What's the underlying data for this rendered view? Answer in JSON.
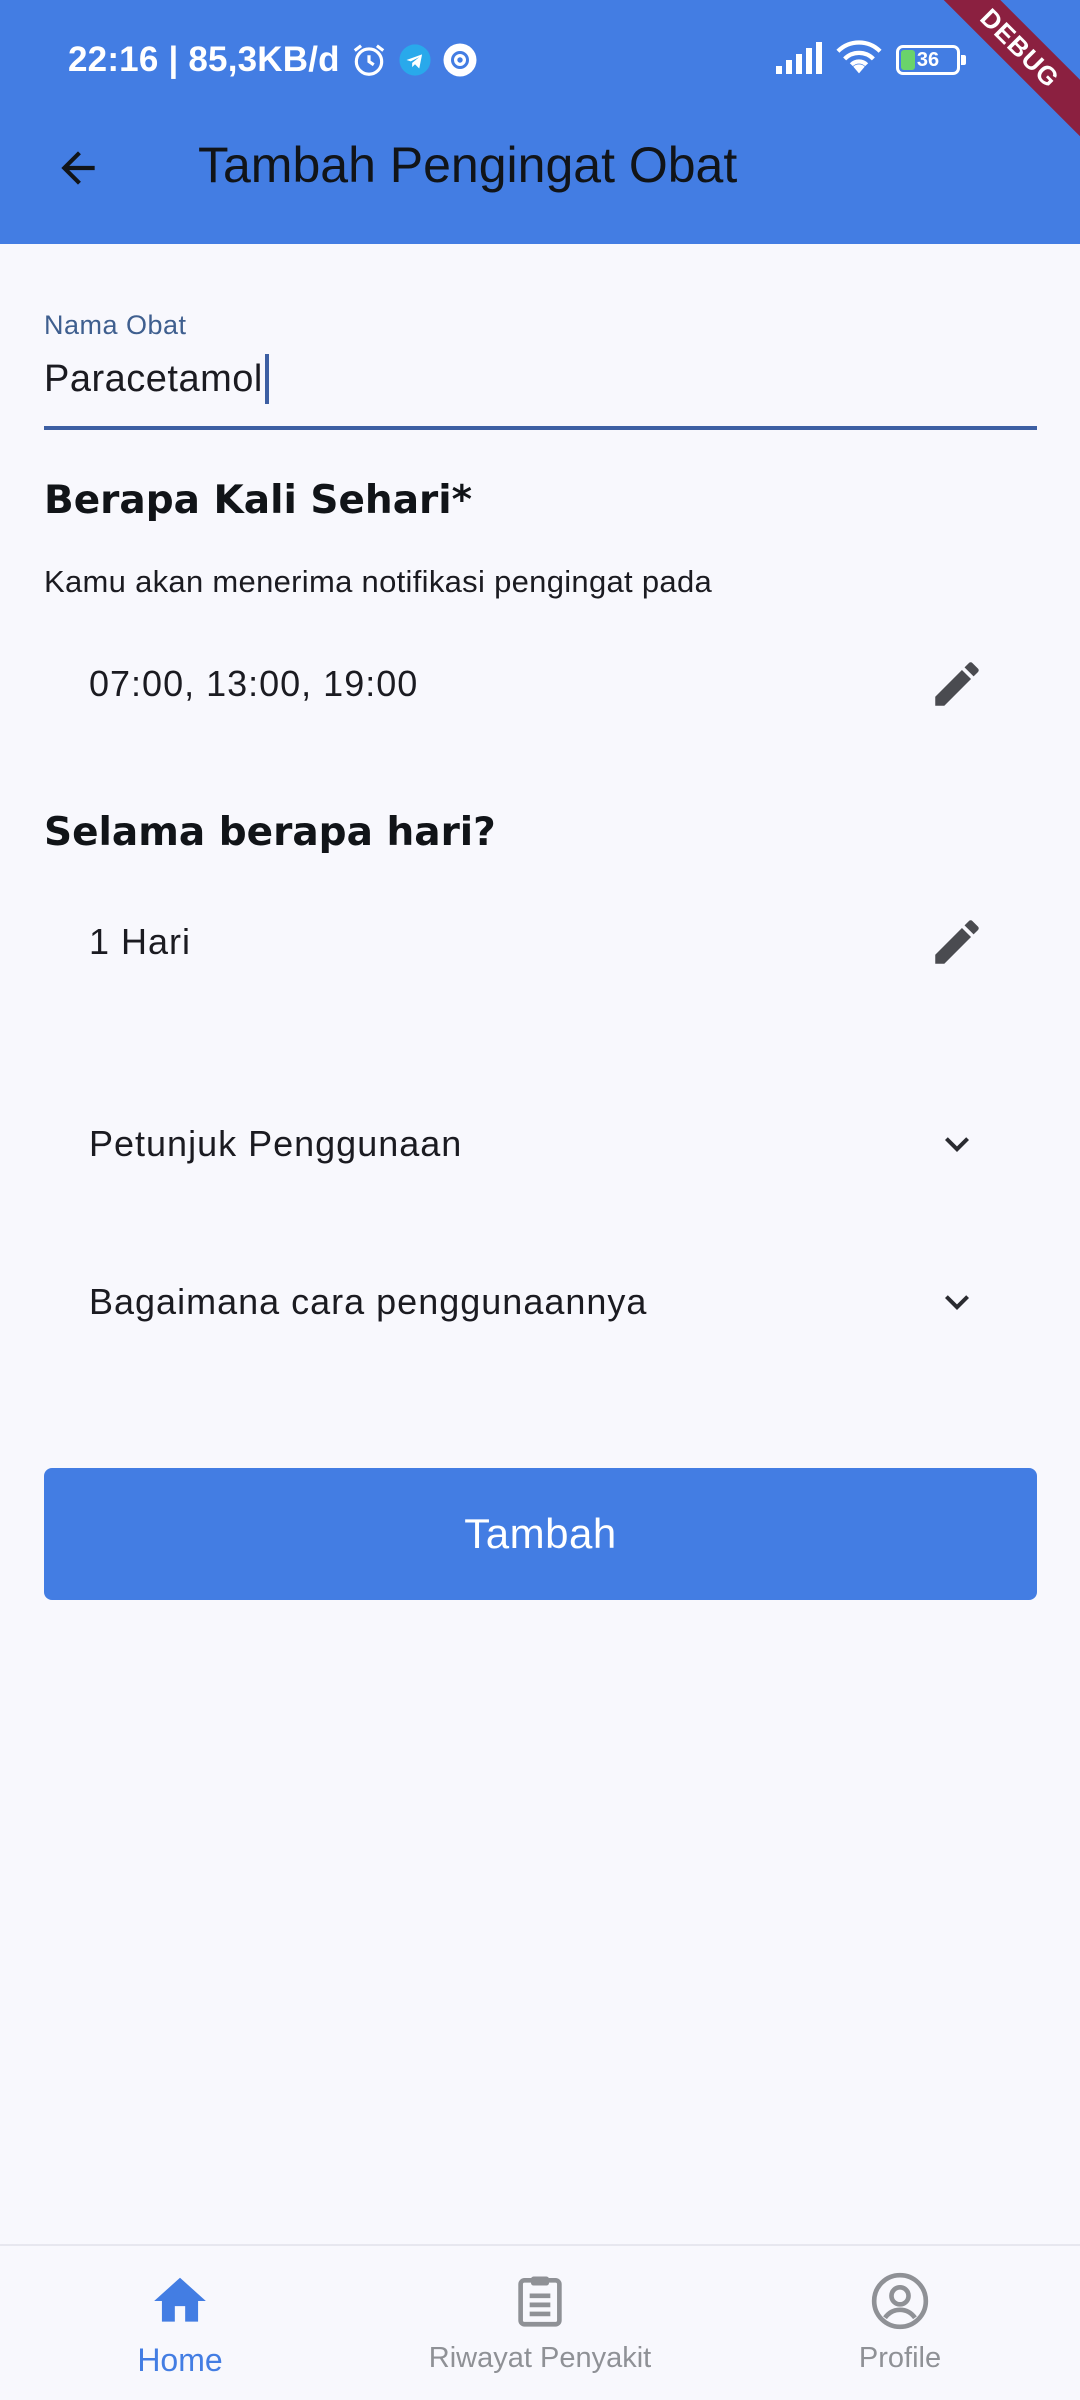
{
  "status_bar": {
    "time_info": "22:16 | 85,3KB/d",
    "battery": "36",
    "debug_label": "DEBUG"
  },
  "app_bar": {
    "title": "Tambah Pengingat Obat"
  },
  "form": {
    "medicine": {
      "label": "Nama Obat",
      "value": "Paracetamol"
    },
    "frequency": {
      "title": "Berapa Kali Sehari*",
      "helper": "Kamu akan menerima notifikasi pengingat pada",
      "times": "07:00, 13:00, 19:00"
    },
    "duration": {
      "title": "Selama berapa hari?",
      "value": "1 Hari"
    },
    "instructions": {
      "label": "Petunjuk Penggunaan"
    },
    "usage": {
      "label": "Bagaimana cara penggunaannya"
    },
    "submit_label": "Tambah"
  },
  "bottom_nav": {
    "items": [
      {
        "label": "Home",
        "icon": "home-icon",
        "active": true
      },
      {
        "label": "Riwayat Penyakit",
        "icon": "clipboard-icon",
        "active": false
      },
      {
        "label": "Profile",
        "icon": "account-circle-icon",
        "active": false
      }
    ]
  },
  "colors": {
    "primary": "#437de3",
    "background": "#f8f8fd",
    "inactive_nav": "#8f9196",
    "ribbon": "#8b2040"
  }
}
